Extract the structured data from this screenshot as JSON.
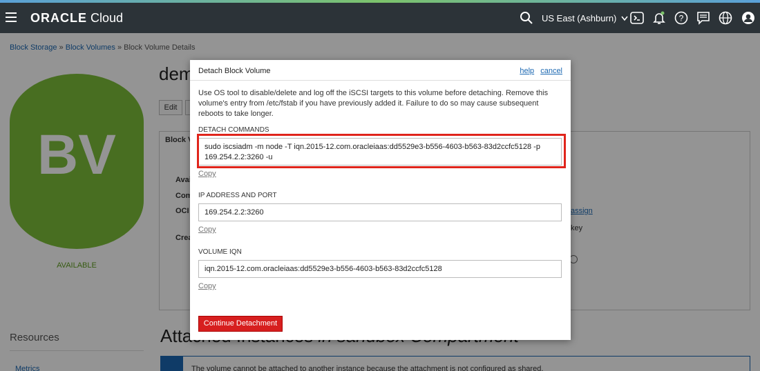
{
  "topbar": {
    "brand_bold": "ORACLE",
    "brand_rest": " Cloud",
    "region": "US East (Ashburn)"
  },
  "breadcrumb": {
    "items": [
      "Block Storage",
      "Block Volumes"
    ],
    "current": "Block Volume Details",
    "separator": "»"
  },
  "volume": {
    "badge": "BV",
    "status": "AVAILABLE",
    "title_partial": "dem",
    "edit_label": "Edit",
    "tab_partial": "Block V",
    "labels_partial": [
      "Avai",
      "Com",
      "OCI",
      "Crea"
    ],
    "assign_partial": "assign",
    "key_partial": "key"
  },
  "resources": {
    "title": "Resources",
    "metrics": "Metrics"
  },
  "attached": {
    "heading_a": "Attached Instances",
    "heading_b": " in sandbox Compartment",
    "notice": "The volume cannot be attached to another instance because the attachment is not configured as shared."
  },
  "dialog": {
    "title": "Detach Block Volume",
    "help": "help",
    "cancel": "cancel",
    "description": "Use OS tool to disable/delete and log off the iSCSI targets to this volume before detaching. Remove this volume's entry from /etc/fstab if you have previously added it. Failure to do so may cause subsequent reboots to take longer.",
    "detach_commands_label": "DETACH COMMANDS",
    "detach_commands": "sudo iscsiadm -m node -T iqn.2015-12.com.oracleiaas:dd5529e3-b556-4603-b563-83d2ccfc5128 -p 169.254.2.2:3260 -u",
    "copy": "Copy",
    "ip_label": "IP ADDRESS AND PORT",
    "ip_value": "169.254.2.2:3260",
    "iqn_label": "VOLUME IQN",
    "iqn_value": "iqn.2015-12.com.oracleiaas:dd5529e3-b556-4603-b563-83d2ccfc5128",
    "continue_label": "Continue Detachment"
  },
  "icons": [
    "hamburger-icon",
    "search-icon",
    "chevron-down-icon",
    "cloud-shell-icon",
    "bell-icon",
    "help-icon",
    "chat-icon",
    "globe-icon",
    "user-icon"
  ]
}
